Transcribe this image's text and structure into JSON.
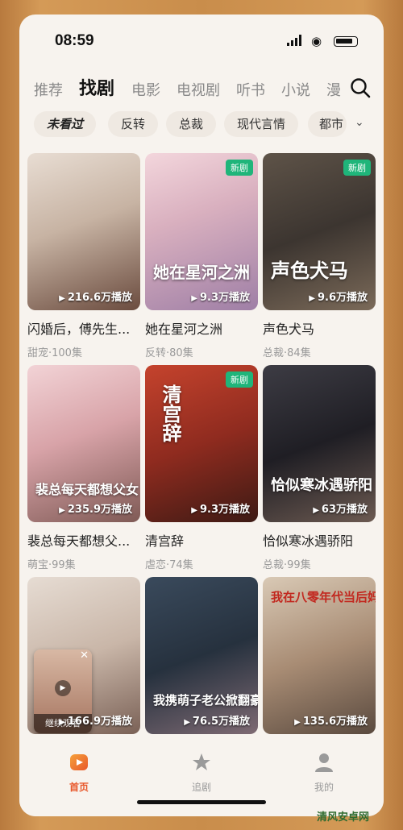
{
  "status_bar": {
    "time": "08:59"
  },
  "nav_tabs": [
    "推荐",
    "找剧",
    "电影",
    "电视剧",
    "听书",
    "小说",
    "漫"
  ],
  "filters": [
    "未看过",
    "反转",
    "总裁",
    "现代言情",
    "都市"
  ],
  "cards": [
    {
      "poster_text": "",
      "plays": "216.6万播放",
      "title": "闪婚后，傅先生...",
      "meta": "甜宠·100集",
      "badge": ""
    },
    {
      "poster_text": "她在星河之洲",
      "plays": "9.3万播放",
      "title": "她在星河之洲",
      "meta": "反转·80集",
      "badge": "新剧"
    },
    {
      "poster_text": "声色犬马",
      "plays": "9.6万播放",
      "title": "声色犬马",
      "meta": "总裁·84集",
      "badge": "新剧"
    },
    {
      "poster_text": "裴总每天都想父女",
      "plays": "235.9万播放",
      "title": "裴总每天都想父...",
      "meta": "萌宝·99集",
      "badge": ""
    },
    {
      "poster_text": "清宫辞",
      "plays": "9.3万播放",
      "title": "清宫辞",
      "meta": "虐恋·74集",
      "badge": "新剧"
    },
    {
      "poster_text": "恰似寒冰遇骄阳",
      "plays": "63万播放",
      "title": "恰似寒冰遇骄阳",
      "meta": "总裁·99集",
      "badge": ""
    },
    {
      "poster_text": "",
      "plays": "166.9万播放",
      "title": "",
      "meta": "",
      "badge": ""
    },
    {
      "poster_text": "我携萌子老公掀翻豪门",
      "plays": "76.5万播放",
      "title": "",
      "meta": "",
      "badge": ""
    },
    {
      "poster_text": "我在八零年代当后妈",
      "plays": "135.6万播放",
      "title": "",
      "meta": "",
      "badge": ""
    }
  ],
  "resume_popup": {
    "label": "继续观看"
  },
  "bottom_nav": [
    "首页",
    "追剧",
    "我的"
  ],
  "watermark": "清风安卓网",
  "colors": {
    "accent": "#e8572a",
    "new_badge": "#1fb57a",
    "background": "#f7f3ee"
  }
}
